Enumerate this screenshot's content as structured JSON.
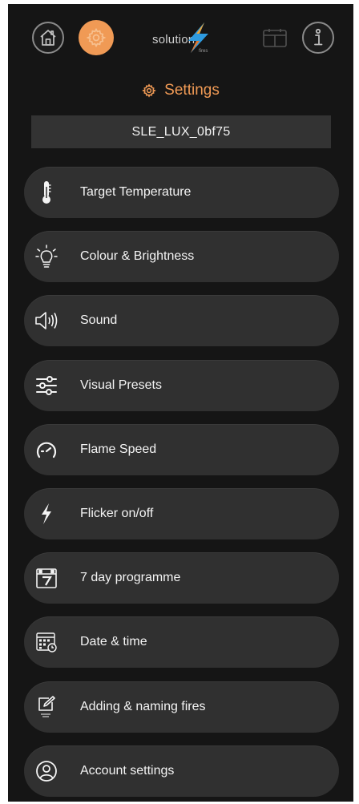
{
  "header": {
    "logo_text": "solution",
    "logo_sub": "fires",
    "page_title": "Settings",
    "device_name": "SLE_LUX_0bf75"
  },
  "icons": {
    "top": [
      "home-icon",
      "gear-icon",
      "calendar-icon",
      "info-icon"
    ],
    "accent_color": "#f09a55"
  },
  "menu": {
    "items": [
      {
        "label": "Target Temperature",
        "icon": "thermometer-icon"
      },
      {
        "label": "Colour & Brightness",
        "icon": "lightbulb-icon"
      },
      {
        "label": "Sound",
        "icon": "speaker-icon"
      },
      {
        "label": "Visual Presets",
        "icon": "sliders-icon"
      },
      {
        "label": "Flame Speed",
        "icon": "speedometer-icon"
      },
      {
        "label": "Flicker on/off",
        "icon": "lightning-icon"
      },
      {
        "label": "7 day programme",
        "icon": "calendar-7-icon"
      },
      {
        "label": "Date & time",
        "icon": "calendar-clock-icon"
      },
      {
        "label": "Adding & naming fires",
        "icon": "edit-icon"
      },
      {
        "label": "Account settings",
        "icon": "account-icon"
      }
    ]
  }
}
